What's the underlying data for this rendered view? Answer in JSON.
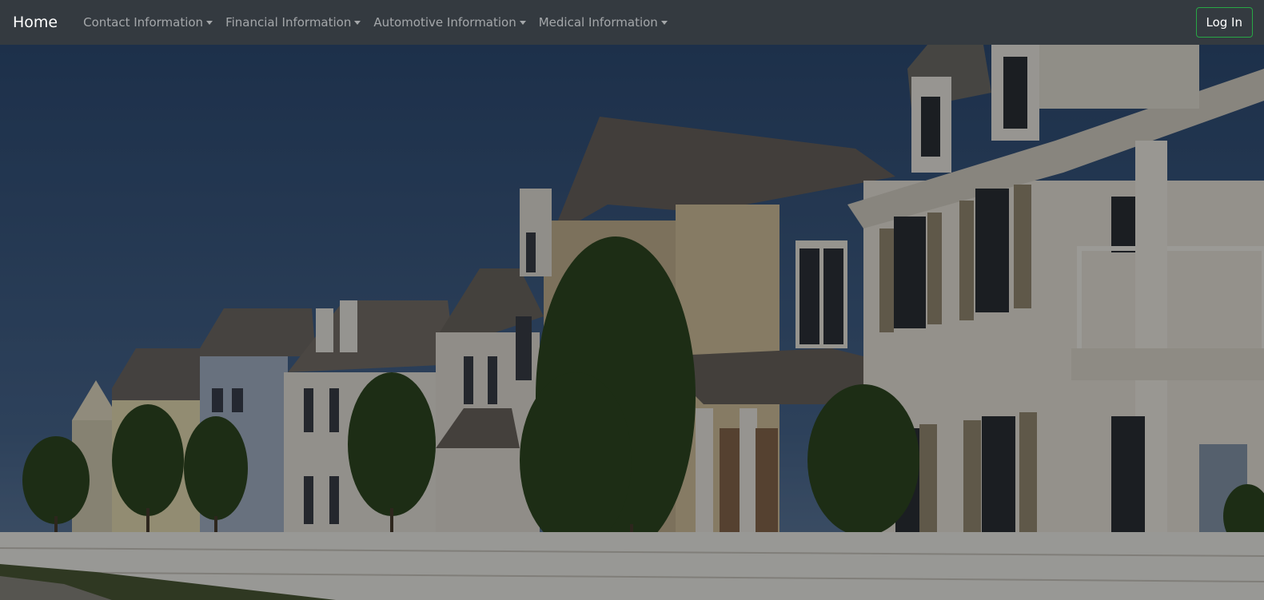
{
  "navbar": {
    "brand": "Home",
    "items": [
      {
        "label": "Contact Information"
      },
      {
        "label": "Financial Information"
      },
      {
        "label": "Automotive Information"
      },
      {
        "label": "Medical Information"
      }
    ],
    "login_label": "Log In"
  },
  "colors": {
    "navbar_bg": "#343a40",
    "login_border": "#28a745"
  },
  "hero": {
    "image": "suburban-row-houses-photo"
  }
}
